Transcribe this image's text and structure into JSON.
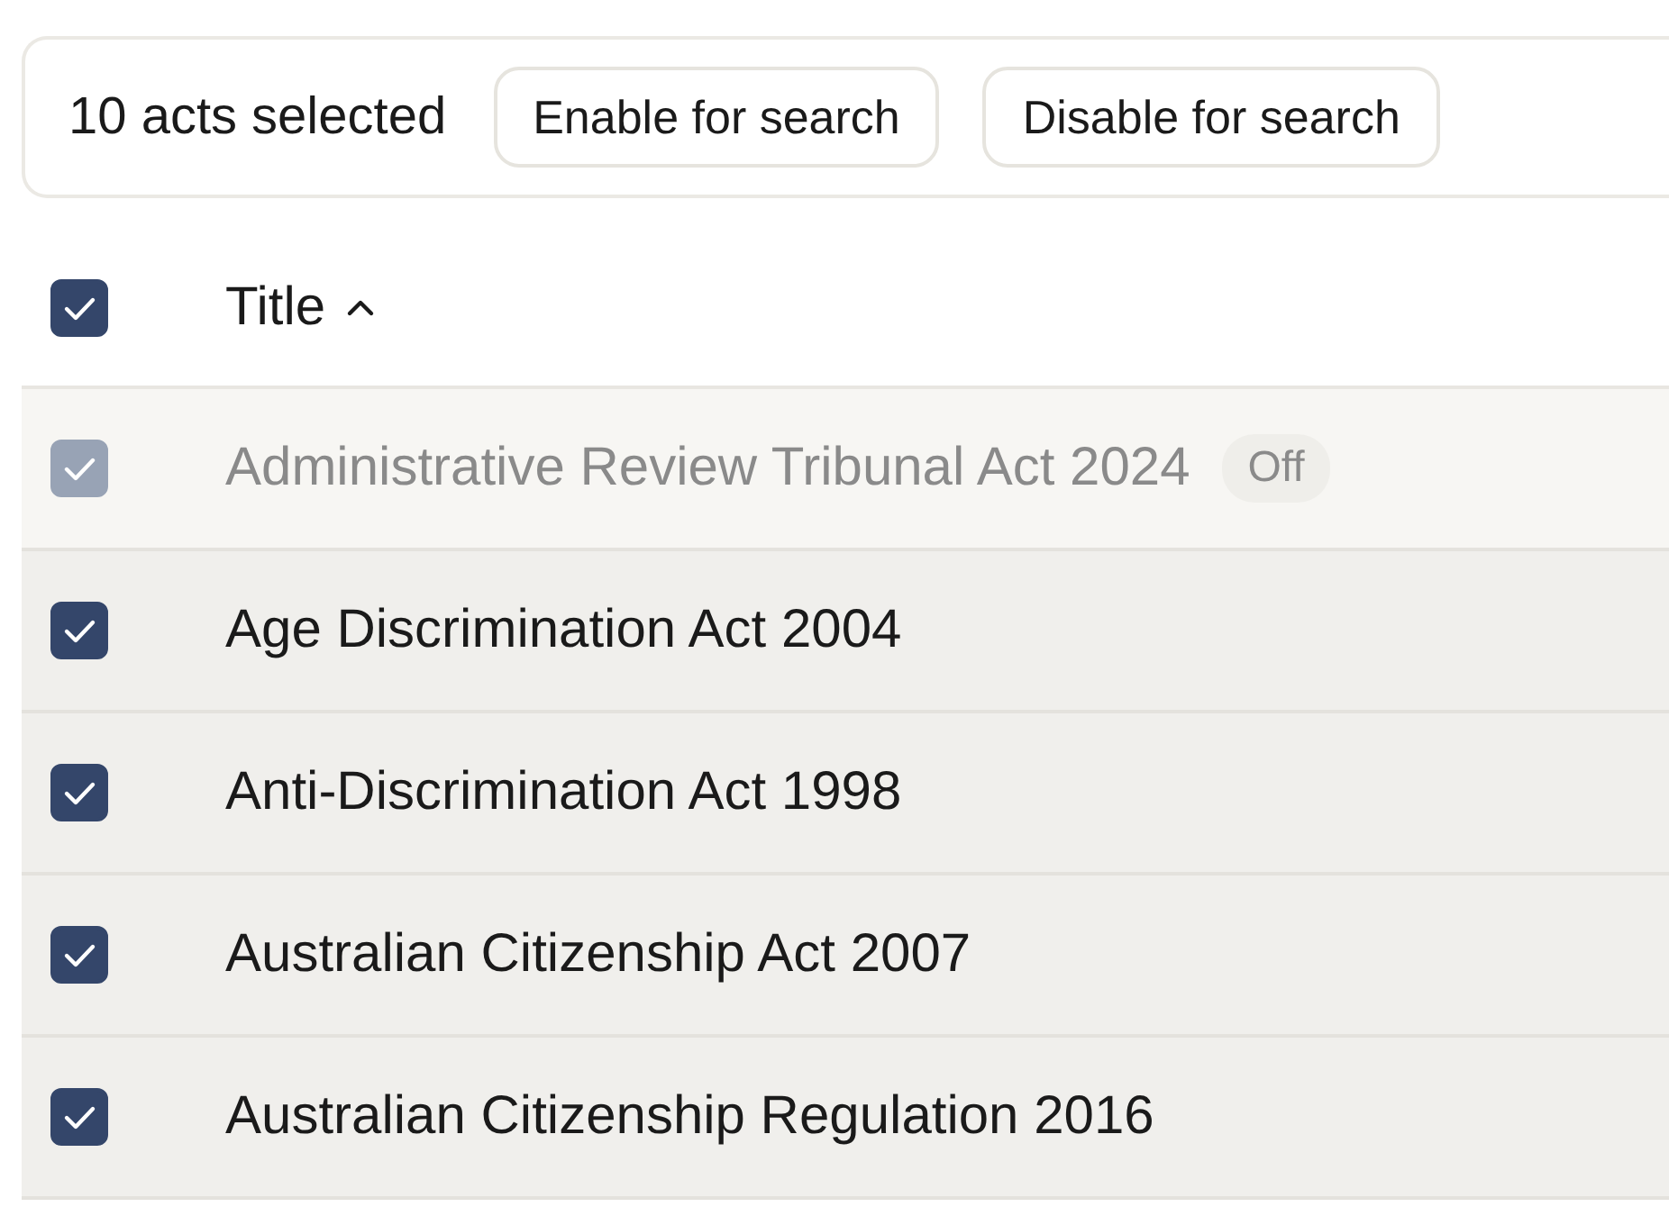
{
  "toolbar": {
    "selection_count": "10 acts selected",
    "buttons": [
      "Enable for search",
      "Disable for search"
    ]
  },
  "table": {
    "header": {
      "checked": true,
      "title": "Title",
      "sort_ascending": true
    },
    "rows": [
      {
        "title": "Administrative Review Tribunal Act 2024",
        "checked": true,
        "disabled": true,
        "badge": "Off"
      },
      {
        "title": "Age Discrimination Act 2004",
        "checked": true,
        "disabled": false
      },
      {
        "title": "Anti-Discrimination Act 1998",
        "checked": true,
        "disabled": false
      },
      {
        "title": "Australian Citizenship Act 2007",
        "checked": true,
        "disabled": false
      },
      {
        "title": "Australian Citizenship Regulation 2016",
        "checked": true,
        "disabled": false
      }
    ]
  }
}
